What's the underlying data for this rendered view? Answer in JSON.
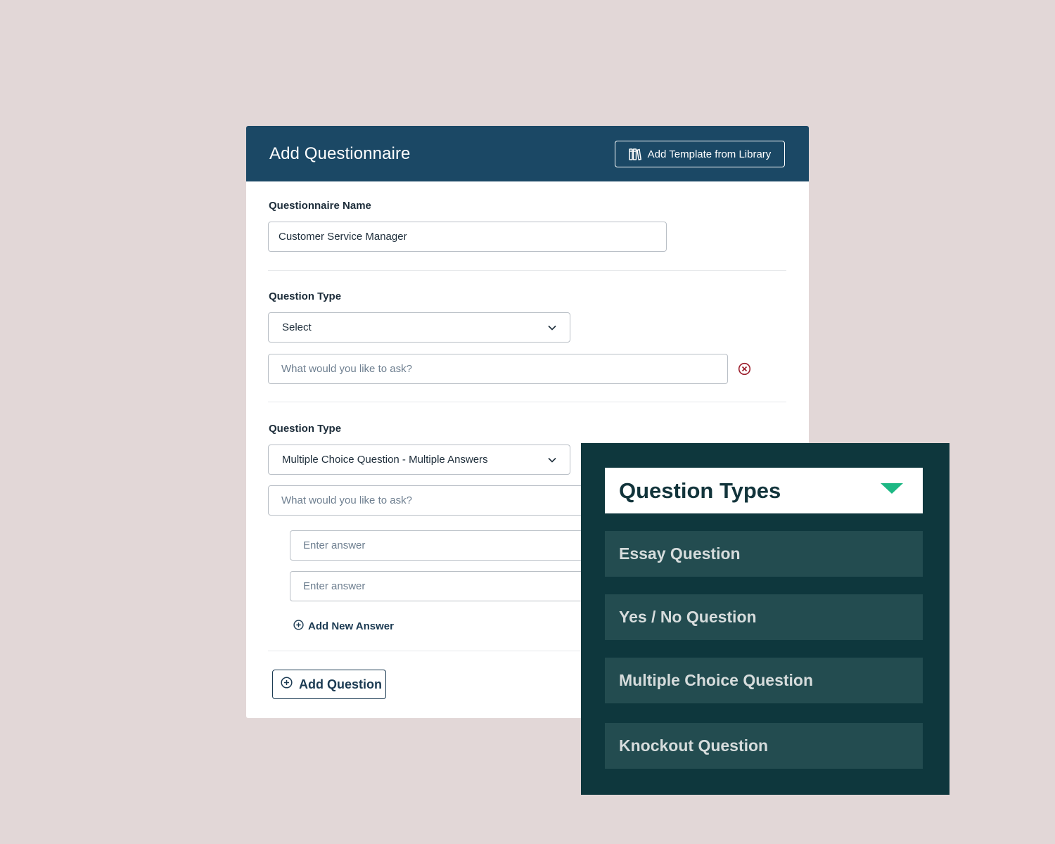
{
  "form": {
    "title": "Add Questionnaire",
    "template_button_label": "Add Template from Library",
    "name_label": "Questionnaire Name",
    "name_value": "Customer Service Manager",
    "questions": [
      {
        "type_label": "Question Type",
        "type_value": "Select",
        "question_placeholder": "What would you like to ask?"
      },
      {
        "type_label": "Question Type",
        "type_value": "Multiple Choice Question - Multiple Answers",
        "question_placeholder": "What would you like to ask?",
        "answers": [
          {
            "placeholder": "Enter answer"
          },
          {
            "placeholder": "Enter answer"
          }
        ],
        "add_answer_label": "Add New Answer"
      }
    ],
    "add_question_label": "Add Question"
  },
  "question_types_panel": {
    "title": "Question Types",
    "items": [
      {
        "label": "Essay Question"
      },
      {
        "label": "Yes / No Question"
      },
      {
        "label": "Multiple Choice Question"
      },
      {
        "label": "Knockout Question"
      }
    ]
  },
  "colors": {
    "background": "#e2d7d7",
    "header": "#1b4865",
    "panel": "#0e373d",
    "panel_item": "#234c50",
    "accent": "#1db884",
    "danger": "#9b1c2a"
  }
}
